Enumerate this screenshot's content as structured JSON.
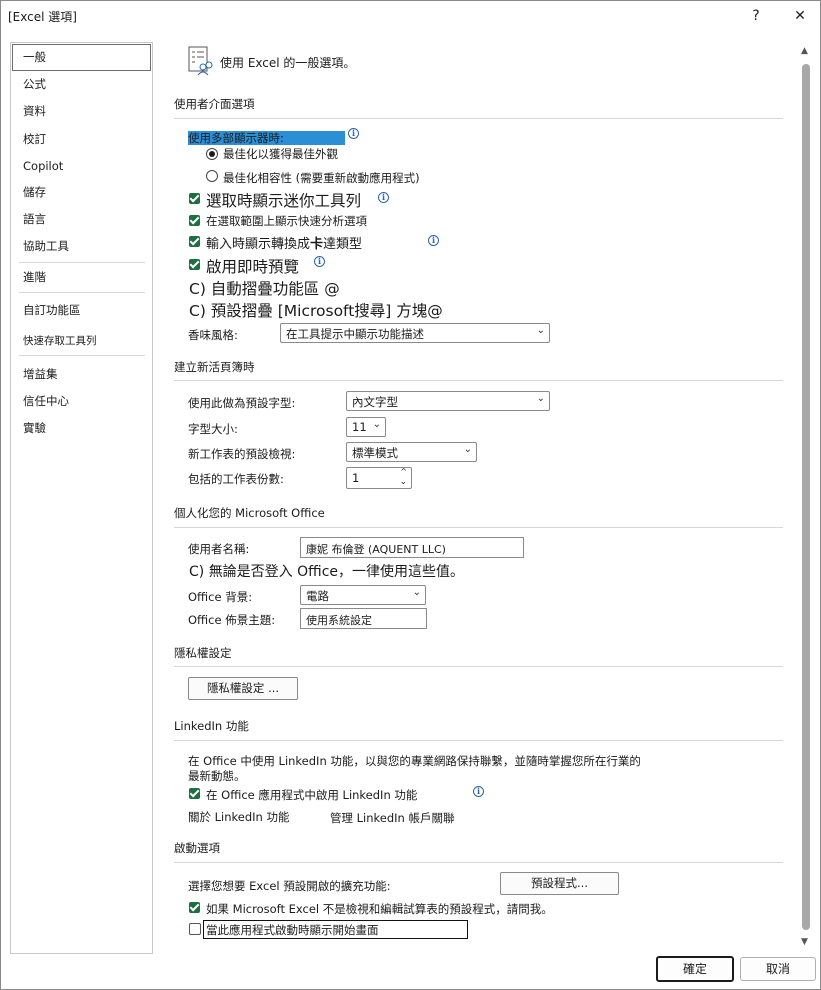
{
  "window": {
    "title": "[Excel 選項]",
    "help_label": "?",
    "close_label": "✕"
  },
  "sidebar": {
    "items": [
      {
        "label": "一般"
      },
      {
        "label": "公式"
      },
      {
        "label": "資料"
      },
      {
        "label": "校訂"
      },
      {
        "label": "Copilot"
      },
      {
        "label": "儲存"
      },
      {
        "label": "語言"
      },
      {
        "label": "協助工具"
      },
      {
        "label": "進階"
      },
      {
        "label": "自訂功能區"
      },
      {
        "label": "快速存取工具列"
      },
      {
        "label": "增益集"
      },
      {
        "label": "信任中心"
      },
      {
        "label": "實驗"
      }
    ]
  },
  "header": {
    "text": "使用 Excel 的一般選項。",
    "icon": "general-options-icon"
  },
  "ui_options": {
    "title": "使用者介面選項",
    "multi_display_label": "使用多部顯示器時:",
    "radio_appearance": "最佳化以獲得最佳外觀",
    "radio_compat": "最佳化相容性 (需要重新啟動應用程式)",
    "mini_toolbar": "選取時顯示迷你工具列",
    "quick_analysis": "在選取範圍上顯示快速分析選項",
    "convert_data_types": "輸入時顯示轉換成",
    "convert_bold": "卡",
    "convert_suffix": "達類型",
    "live_preview": "啟用即時預覽",
    "collapse_ribbon": "C) 自動摺疊功能區 @",
    "collapse_search": "C) 預設摺疊 [Microsoft搜尋] 方塊@",
    "tooltip_style_label": "香味風格:",
    "tooltip_style_value": "在工具提示中顯示功能描述"
  },
  "new_workbook": {
    "title": "建立新活頁簿時",
    "font_label": "使用此做為預設字型:",
    "font_value": "內文字型",
    "size_label": "字型大小:",
    "size_value": "11",
    "view_label": "新工作表的預設檢視:",
    "view_value": "標準模式",
    "sheets_label": "包括的工作表份數:",
    "sheets_value": "1"
  },
  "personalize": {
    "title": "個人化您的 Microsoft Office",
    "username_label": "使用者名稱:",
    "username_value": "康妮 布倫登 (AQUENT LLC)",
    "always_use": "C) 無論是否登入 Office，一律使用這些值。",
    "background_label": "Office 背景:",
    "background_value": "電路",
    "theme_label": "Office 佈景主題:",
    "theme_value": "使用系統設定"
  },
  "privacy": {
    "title": "隱私權設定",
    "button": "隱私權設定 ..."
  },
  "linkedin": {
    "title": "LinkedIn 功能",
    "desc_line1": "在 Office 中使用 LinkedIn 功能，以與您的專業網路保持聯繫，並隨時掌握您所在行業的",
    "desc_line2": "最新動態。",
    "enable": "在 Office 應用程式中啟用 LinkedIn 功能",
    "about_link": "關於 LinkedIn 功能",
    "manage_link": "管理 LinkedIn 帳戶關聯"
  },
  "startup": {
    "title": "啟動選項",
    "extensions_label": "選擇您想要 Excel 預設開啟的擴充功能:",
    "default_programs": "預設程式...",
    "tell_me": "如果 Microsoft Excel 不是檢視和編輯試算表的預設程式，請問我。",
    "show_start": "當此應用程式啟動時顯示開始畫面"
  },
  "footer": {
    "ok": "確定",
    "cancel": "取消"
  },
  "colors": {
    "accent_green": "#1d6f42",
    "info_blue": "#2a64a8",
    "highlight": "#2b8fd6"
  }
}
